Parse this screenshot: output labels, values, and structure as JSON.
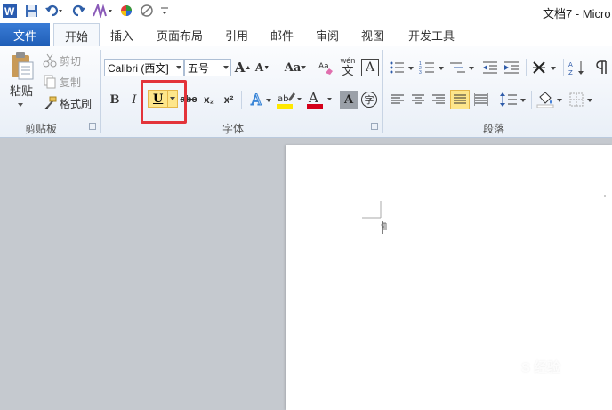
{
  "window": {
    "title": "文档7 - Micro"
  },
  "tabs": {
    "file": "文件",
    "home": "开始",
    "insert": "插入",
    "page_layout": "页面布局",
    "references": "引用",
    "mailings": "邮件",
    "review": "审阅",
    "view": "视图",
    "developer": "开发工具"
  },
  "clipboard": {
    "paste": "粘贴",
    "cut": "剪切",
    "copy": "复制",
    "format_painter": "格式刷",
    "group_label": "剪贴板"
  },
  "font": {
    "font_name": "Calibri (西文]",
    "font_size": "五号",
    "group_label": "字体",
    "bold": "B",
    "italic": "I",
    "underline": "U",
    "strikethrough": "abc",
    "subscript": "x₂",
    "superscript": "x²",
    "grow": "A",
    "shrink": "A",
    "change_case": "Aa",
    "font_color_glyph": "A",
    "phonetic_top": "wén",
    "phonetic_char": "文",
    "enclose_char": "字"
  },
  "paragraph": {
    "group_label": "段落"
  },
  "watermark": {
    "text": "S 经验"
  },
  "colors": {
    "file_tab": "#2a6cc9",
    "underline_active": "#fde68b",
    "highlight_box": "#e3333a",
    "font_color_bar": "#d4001a",
    "highlight_color_bar": "#ffe800"
  }
}
